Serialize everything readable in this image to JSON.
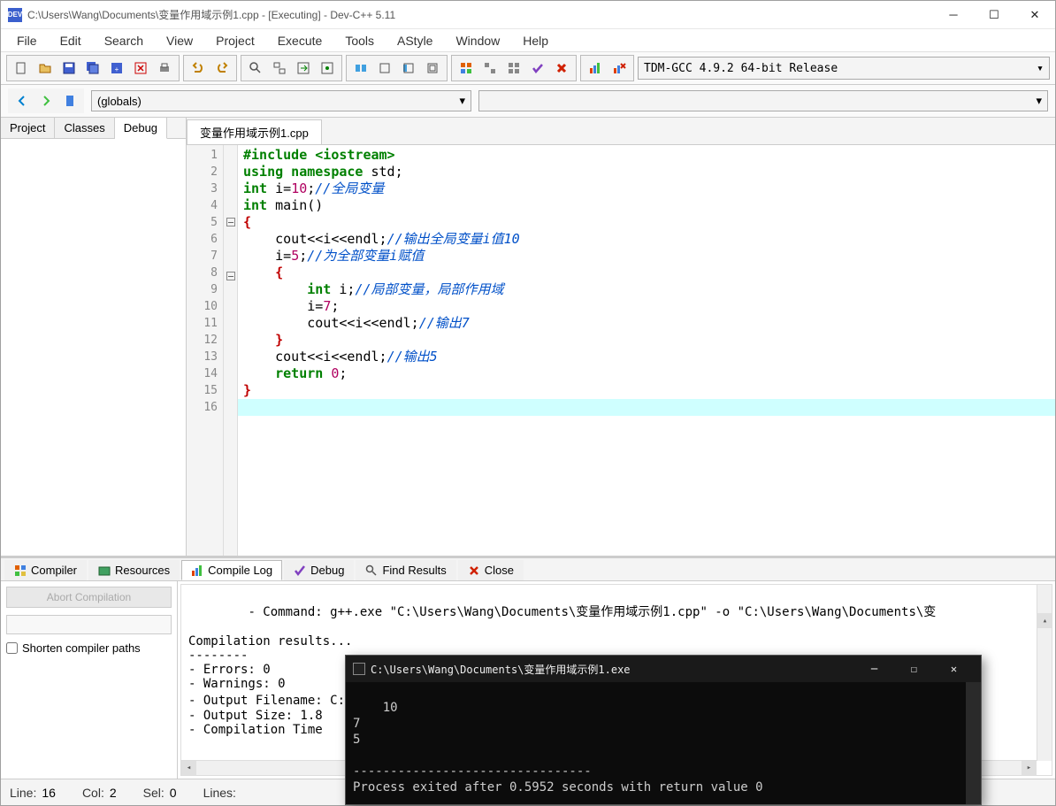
{
  "titlebar": {
    "icon_label": "DEV",
    "text": "C:\\Users\\Wang\\Documents\\变量作用域示例1.cpp - [Executing] - Dev-C++ 5.11"
  },
  "menubar": [
    "File",
    "Edit",
    "Search",
    "View",
    "Project",
    "Execute",
    "Tools",
    "AStyle",
    "Window",
    "Help"
  ],
  "compiler_profile": "TDM-GCC 4.9.2 64-bit Release",
  "scope": "(globals)",
  "left_tabs": [
    "Project",
    "Classes",
    "Debug"
  ],
  "left_active": "Debug",
  "editor_tab": "变量作用域示例1.cpp",
  "code_lines": [
    {
      "n": 1,
      "tokens": [
        {
          "t": "#include <iostream>",
          "c": "pp"
        }
      ]
    },
    {
      "n": 2,
      "tokens": [
        {
          "t": "using namespace",
          "c": "kw"
        },
        {
          "t": " std;",
          "c": ""
        }
      ]
    },
    {
      "n": 3,
      "tokens": [
        {
          "t": "int",
          "c": "kw"
        },
        {
          "t": " i=",
          "c": ""
        },
        {
          "t": "10",
          "c": "num"
        },
        {
          "t": ";",
          "c": ""
        },
        {
          "t": "//全局变量",
          "c": "cmt"
        }
      ]
    },
    {
      "n": 4,
      "tokens": [
        {
          "t": "int",
          "c": "kw"
        },
        {
          "t": " main()",
          "c": ""
        }
      ]
    },
    {
      "n": 5,
      "fold": true,
      "tokens": [
        {
          "t": "{",
          "c": "brace"
        }
      ]
    },
    {
      "n": 6,
      "tokens": [
        {
          "t": "    cout<<i<<endl;",
          "c": ""
        },
        {
          "t": "//输出全局变量i值10",
          "c": "cmt"
        }
      ]
    },
    {
      "n": 7,
      "tokens": [
        {
          "t": "    i=",
          "c": ""
        },
        {
          "t": "5",
          "c": "num"
        },
        {
          "t": ";",
          "c": ""
        },
        {
          "t": "//为全部变量i赋值",
          "c": "cmt"
        }
      ]
    },
    {
      "n": 8,
      "fold": true,
      "tokens": [
        {
          "t": "    ",
          "c": ""
        },
        {
          "t": "{",
          "c": "brace"
        }
      ]
    },
    {
      "n": 9,
      "tokens": [
        {
          "t": "        ",
          "c": ""
        },
        {
          "t": "int",
          "c": "kw"
        },
        {
          "t": " i;",
          "c": ""
        },
        {
          "t": "//局部变量，局部作用域",
          "c": "cmt"
        }
      ]
    },
    {
      "n": 10,
      "tokens": [
        {
          "t": "        i=",
          "c": ""
        },
        {
          "t": "7",
          "c": "num"
        },
        {
          "t": ";",
          "c": ""
        }
      ]
    },
    {
      "n": 11,
      "tokens": [
        {
          "t": "        cout<<i<<endl;",
          "c": ""
        },
        {
          "t": "//输出7",
          "c": "cmt"
        }
      ]
    },
    {
      "n": 12,
      "tokens": [
        {
          "t": "    ",
          "c": ""
        },
        {
          "t": "}",
          "c": "brace"
        }
      ]
    },
    {
      "n": 13,
      "tokens": [
        {
          "t": "    cout<<i<<endl;",
          "c": ""
        },
        {
          "t": "//输出5",
          "c": "cmt"
        }
      ]
    },
    {
      "n": 14,
      "tokens": [
        {
          "t": "",
          "c": ""
        }
      ]
    },
    {
      "n": 15,
      "tokens": [
        {
          "t": "    ",
          "c": ""
        },
        {
          "t": "return",
          "c": "kw"
        },
        {
          "t": " ",
          "c": ""
        },
        {
          "t": "0",
          "c": "num"
        },
        {
          "t": ";",
          "c": ""
        }
      ]
    },
    {
      "n": 16,
      "hl": true,
      "tokens": [
        {
          "t": "}",
          "c": "brace"
        }
      ]
    }
  ],
  "bottom_tabs": [
    {
      "label": "Compiler",
      "icon": "grid"
    },
    {
      "label": "Resources",
      "icon": "res"
    },
    {
      "label": "Compile Log",
      "icon": "chart",
      "active": true
    },
    {
      "label": "Debug",
      "icon": "check"
    },
    {
      "label": "Find Results",
      "icon": "find"
    },
    {
      "label": "Close",
      "icon": "close"
    }
  ],
  "abort_label": "Abort Compilation",
  "shorten_label": "Shorten compiler paths",
  "compile_log": "- Command: g++.exe \"C:\\Users\\Wang\\Documents\\变量作用域示例1.cpp\" -o \"C:\\Users\\Wang\\Documents\\变\n\nCompilation results...\n--------\n- Errors: 0\n- Warnings: 0\n- Output Filename: C:\\Users\\Wang\\Documents\\变量作用域示例1.exe\n- Output Size: 1.8\n- Compilation Time",
  "status": {
    "line_label": "Line:",
    "line": "16",
    "col_label": "Col:",
    "col": "2",
    "sel_label": "Sel:",
    "sel": "0",
    "lines_label": "Lines:",
    "lines": ""
  },
  "console": {
    "title": "C:\\Users\\Wang\\Documents\\变量作用域示例1.exe",
    "output": "10\n7\n5\n\n--------------------------------\nProcess exited after 0.5952 seconds with return value 0"
  }
}
